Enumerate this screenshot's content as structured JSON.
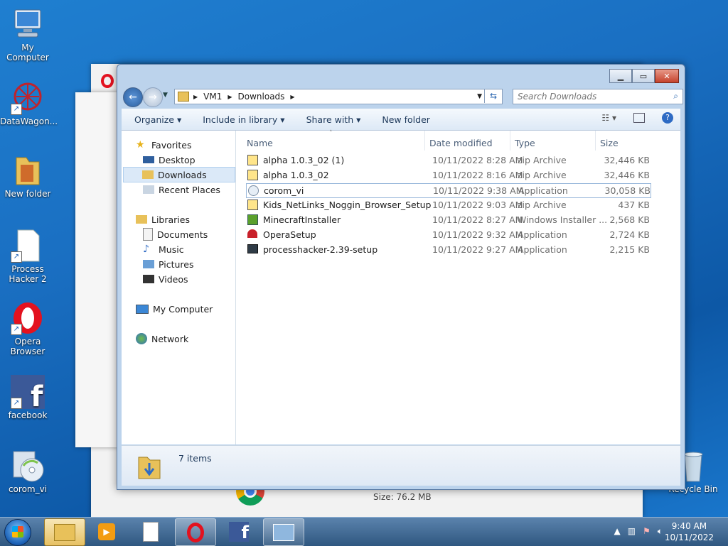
{
  "desktop": {
    "icons": [
      {
        "label": "My Computer"
      },
      {
        "label": "DataWagon..."
      },
      {
        "label": "New folder"
      },
      {
        "label": "Process Hacker 2"
      },
      {
        "label": "Opera Browser"
      },
      {
        "label": "facebook"
      },
      {
        "label": "corom_vi"
      },
      {
        "label": "Recycle Bin"
      }
    ],
    "background_window": {
      "size_label": "Size: 76.2 MB"
    }
  },
  "explorer": {
    "breadcrumb": [
      "VM1",
      "Downloads"
    ],
    "search_placeholder": "Search Downloads",
    "toolbar": {
      "organize": "Organize",
      "include_in_library": "Include in library",
      "share_with": "Share with",
      "new_folder": "New folder"
    },
    "nav": {
      "favorites": "Favorites",
      "desktop": "Desktop",
      "downloads": "Downloads",
      "recent_places": "Recent Places",
      "libraries": "Libraries",
      "documents": "Documents",
      "music": "Music",
      "pictures": "Pictures",
      "videos": "Videos",
      "my_computer": "My Computer",
      "network": "Network"
    },
    "columns": {
      "name": "Name",
      "date": "Date modified",
      "type": "Type",
      "size": "Size"
    },
    "files": [
      {
        "name": "alpha 1.0.3_02 (1)",
        "date": "10/11/2022 8:28 AM",
        "type": "zip Archive",
        "size": "32,446 KB"
      },
      {
        "name": "alpha 1.0.3_02",
        "date": "10/11/2022 8:16 AM",
        "type": "zip Archive",
        "size": "32,446 KB"
      },
      {
        "name": "corom_vi",
        "date": "10/11/2022 9:38 AM",
        "type": "Application",
        "size": "30,058 KB"
      },
      {
        "name": "Kids_NetLinks_Noggin_Browser_Setup",
        "date": "10/11/2022 9:03 AM",
        "type": "zip Archive",
        "size": "437 KB"
      },
      {
        "name": "MinecraftInstaller",
        "date": "10/11/2022 8:27 AM",
        "type": "Windows Installer ...",
        "size": "2,568 KB"
      },
      {
        "name": "OperaSetup",
        "date": "10/11/2022 9:32 AM",
        "type": "Application",
        "size": "2,724 KB"
      },
      {
        "name": "processhacker-2.39-setup",
        "date": "10/11/2022 9:27 AM",
        "type": "Application",
        "size": "2,215 KB"
      }
    ],
    "status": {
      "item_count": "7 items"
    }
  },
  "taskbar": {
    "clock_time": "9:40 AM",
    "clock_date": "10/11/2022"
  }
}
